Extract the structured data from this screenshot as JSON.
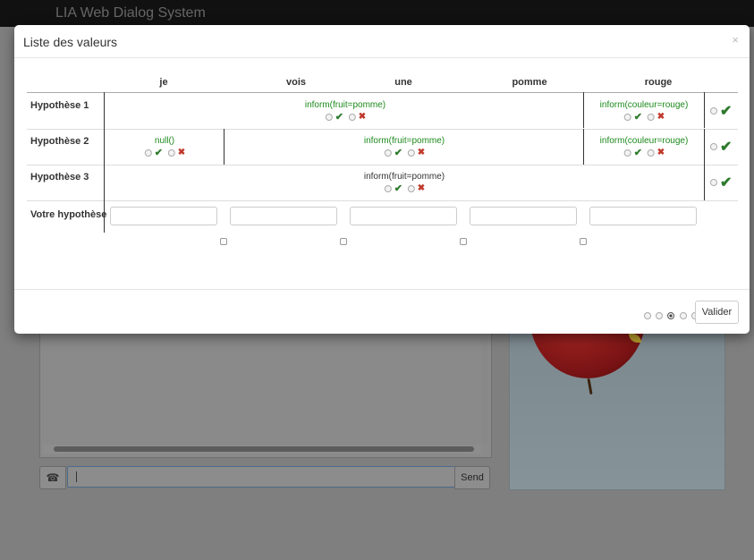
{
  "app": {
    "brand": "LIA Web Dialog System",
    "send_label": "Send"
  },
  "modal": {
    "title": "Liste des valeurs",
    "close_symbol": "×",
    "columns": [
      "je",
      "vois",
      "une",
      "pomme",
      "rouge"
    ],
    "rows": [
      {
        "label": "Hypothèse 1",
        "segments": [
          {
            "act": "inform(fruit=pomme)",
            "span": "je-pomme"
          },
          {
            "act": "inform(couleur=rouge)",
            "span": "rouge"
          }
        ]
      },
      {
        "label": "Hypothèse 2",
        "segments": [
          {
            "act": "null()",
            "span": "je"
          },
          {
            "act": "inform(fruit=pomme)",
            "span": "vois-pomme"
          },
          {
            "act": "inform(couleur=rouge)",
            "span": "rouge"
          }
        ]
      },
      {
        "label": "Hypothèse 3",
        "segments": [
          {
            "act": "inform(fruit=pomme)",
            "span": "je-rouge"
          }
        ]
      }
    ],
    "user_row_label": "Votre hypothèse",
    "pager_total": 5,
    "pager_active": 3,
    "submit_label": "Valider"
  },
  "icons": {
    "check": "✔",
    "cross": "✖",
    "phone": "☎"
  },
  "colors": {
    "act_text": "#1d8a1d",
    "check": "#2d7a2d",
    "cross": "#c0392b"
  }
}
